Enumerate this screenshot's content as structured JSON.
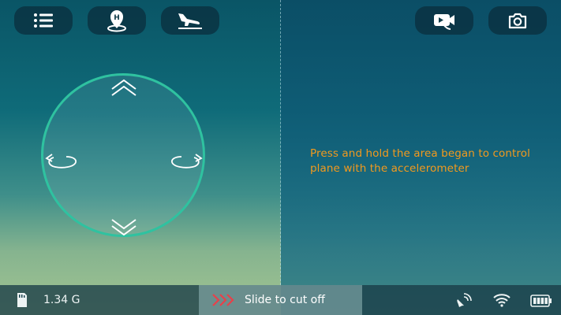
{
  "toolbar": {
    "left_buttons": [
      {
        "icon": "menu-list-icon"
      },
      {
        "icon": "home-location-icon",
        "label": "H"
      },
      {
        "icon": "landing-plane-icon"
      }
    ],
    "right_buttons": [
      {
        "icon": "video-camera-icon"
      },
      {
        "icon": "camera-icon"
      }
    ]
  },
  "joystick": {
    "controls": [
      "forward-arrow",
      "rotate-left",
      "rotate-right",
      "backward-arrow"
    ]
  },
  "hint_text": "Press and hold the area began to control plane with the accelerometer",
  "status": {
    "storage": "1.34 G",
    "slide_label": "Slide to cut off",
    "icons": [
      "satellite-icon",
      "wifi-icon",
      "battery-icon"
    ]
  },
  "colors": {
    "accent_orange": "#f39a1d",
    "joystick_ring": "#2fc2a0"
  }
}
